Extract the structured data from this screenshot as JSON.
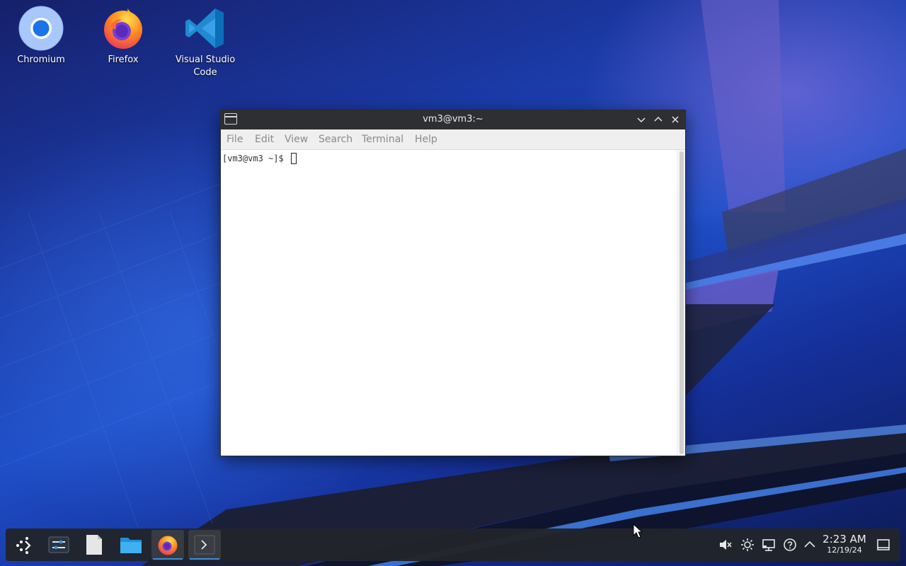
{
  "desktop": {
    "icons": [
      {
        "label": "Chromium",
        "icon": "chromium-icon"
      },
      {
        "label": "Firefox",
        "icon": "firefox-icon"
      },
      {
        "label": "Visual Studio Code",
        "icon": "vscode-icon"
      }
    ]
  },
  "terminal": {
    "title": "vm3@vm3:~",
    "menu": [
      "File",
      "Edit",
      "View",
      "Search",
      "Terminal",
      "Help"
    ],
    "prompt": "[vm3@vm3 ~]$ ",
    "buttons": [
      "minimize-icon",
      "maximize-icon",
      "close-icon"
    ]
  },
  "taskbar": {
    "launchers": [
      "application-launcher-icon",
      "settings-icon",
      "text-editor-icon",
      "file-manager-icon",
      "firefox-icon",
      "terminal-icon"
    ],
    "tray": [
      "volume-muted-icon",
      "brightness-icon",
      "network-icon",
      "help-icon",
      "show-hidden-icons"
    ],
    "clock": {
      "time": "2:23 AM",
      "date": "12/19/24"
    }
  },
  "colors": {
    "accent": "#3d8fd6",
    "titlebar": "#2e2f33",
    "taskbar": "#21242a"
  }
}
